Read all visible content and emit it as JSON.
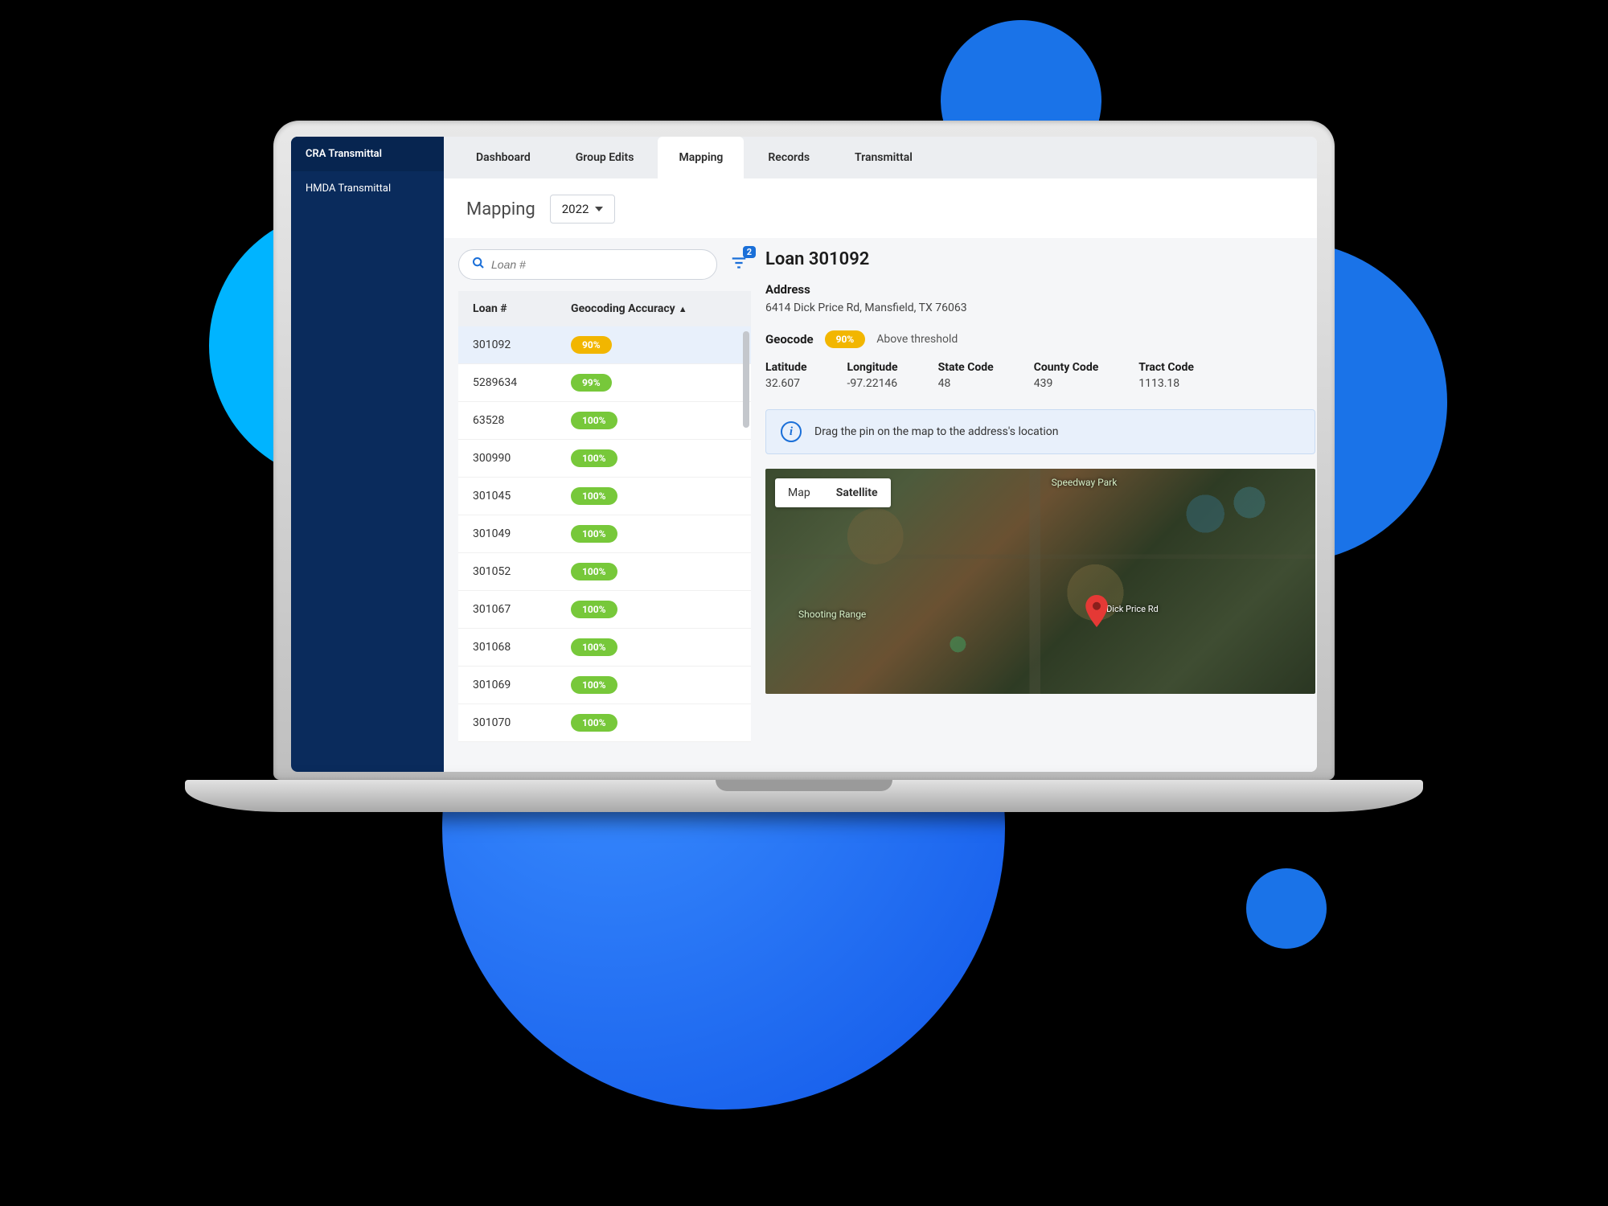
{
  "sidebar": {
    "items": [
      {
        "label": "CRA Transmittal",
        "active": true
      },
      {
        "label": "HMDA Transmittal",
        "active": false
      }
    ]
  },
  "tabs": {
    "items": [
      {
        "label": "Dashboard"
      },
      {
        "label": "Group Edits"
      },
      {
        "label": "Mapping",
        "active": true
      },
      {
        "label": "Records"
      },
      {
        "label": "Transmittal"
      }
    ]
  },
  "page": {
    "title": "Mapping",
    "year": "2022"
  },
  "search": {
    "placeholder": "Loan #"
  },
  "filter": {
    "badge": "2"
  },
  "table": {
    "headers": {
      "loan": "Loan #",
      "accuracy": "Geocoding Accuracy"
    },
    "rows": [
      {
        "loan": "301092",
        "accuracy": "90%",
        "color": "yellow",
        "selected": true
      },
      {
        "loan": "5289634",
        "accuracy": "99%",
        "color": "green"
      },
      {
        "loan": "63528",
        "accuracy": "100%",
        "color": "green"
      },
      {
        "loan": "300990",
        "accuracy": "100%",
        "color": "green"
      },
      {
        "loan": "301045",
        "accuracy": "100%",
        "color": "green"
      },
      {
        "loan": "301049",
        "accuracy": "100%",
        "color": "green"
      },
      {
        "loan": "301052",
        "accuracy": "100%",
        "color": "green"
      },
      {
        "loan": "301067",
        "accuracy": "100%",
        "color": "green"
      },
      {
        "loan": "301068",
        "accuracy": "100%",
        "color": "green"
      },
      {
        "loan": "301069",
        "accuracy": "100%",
        "color": "green"
      },
      {
        "loan": "301070",
        "accuracy": "100%",
        "color": "green"
      }
    ]
  },
  "detail": {
    "title": "Loan 301092",
    "address_label": "Address",
    "address": "6414 Dick Price Rd, Mansfield, TX 76063",
    "geocode_label": "Geocode",
    "geocode_badge": "90%",
    "geocode_status": "Above threshold",
    "fields": [
      {
        "label": "Latitude",
        "value": "32.607"
      },
      {
        "label": "Longitude",
        "value": "-97.22146"
      },
      {
        "label": "State Code",
        "value": "48"
      },
      {
        "label": "County Code",
        "value": "439"
      },
      {
        "label": "Tract Code",
        "value": "1113.18"
      }
    ],
    "info_text": "Drag the pin on the map to the address's location"
  },
  "map": {
    "modes": {
      "map": "Map",
      "satellite": "Satellite"
    },
    "labels": {
      "shooting_range": "Shooting Range",
      "speedway": "Speedway Park",
      "dick_price": "Dick Price Rd"
    }
  }
}
